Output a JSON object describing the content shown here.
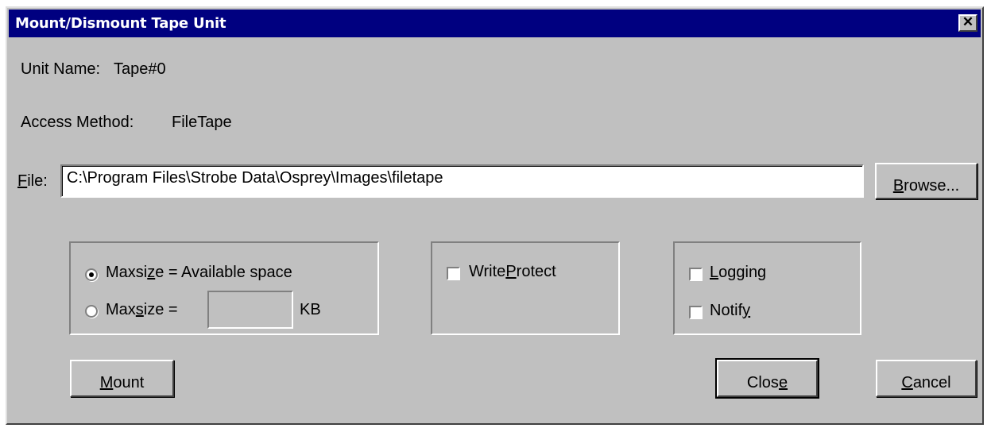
{
  "window": {
    "title": "Mount/Dismount Tape Unit",
    "close_glyph": "✕"
  },
  "info": {
    "unit_name_label": "Unit Name:",
    "unit_name_value": "Tape#0",
    "access_method_label": "Access Method:",
    "access_method_value": "FileTape"
  },
  "file": {
    "label_accel": "F",
    "label_rest": "ile:",
    "value": "C:\\Program Files\\Strobe Data\\Osprey\\Images\\filetape",
    "browse_accel": "B",
    "browse_rest": "rowse..."
  },
  "maxsize": {
    "option1_pre": "Maxsi",
    "option1_accel": "z",
    "option1_post": "e = Available space",
    "option2_pre": "Max",
    "option2_accel": "s",
    "option2_post": "ize =",
    "size_value": "",
    "unit": "KB",
    "selected": "available"
  },
  "options": {
    "write_protect_pre": "Write",
    "write_protect_accel": "P",
    "write_protect_post": "rotect",
    "logging_accel": "L",
    "logging_rest": "ogging",
    "notify_pre": "Notif",
    "notify_accel": "y"
  },
  "buttons": {
    "mount_accel": "M",
    "mount_rest": "ount",
    "close_pre": "Clos",
    "close_accel": "e",
    "cancel_accel": "C",
    "cancel_rest": "ancel"
  }
}
